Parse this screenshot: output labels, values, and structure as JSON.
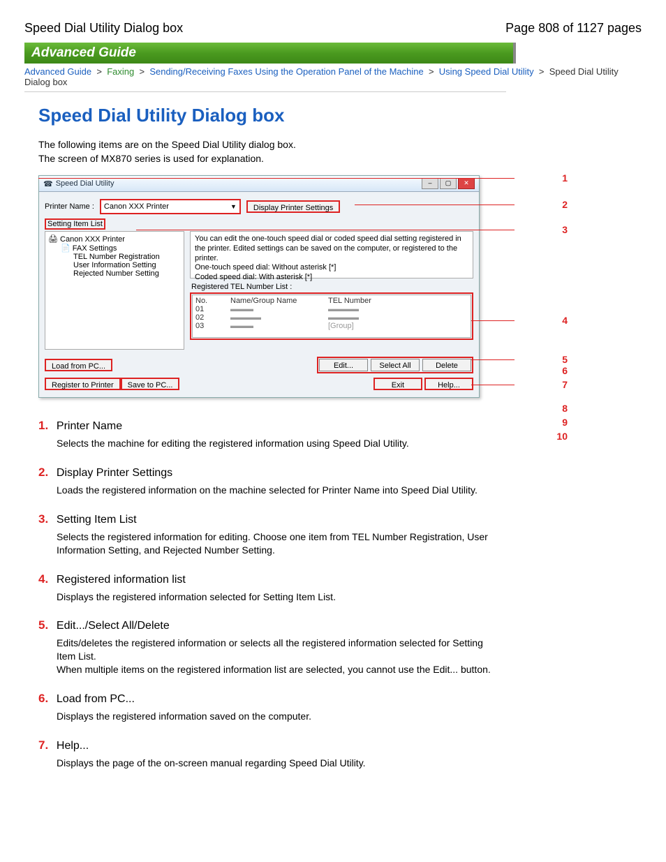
{
  "header": {
    "page_title": "Speed Dial Utility Dialog box",
    "page_counter": "Page 808 of 1127 pages"
  },
  "banner": "Advanced Guide",
  "breadcrumb": {
    "b1": "Advanced Guide",
    "sep": " > ",
    "b2": "Faxing",
    "b3": "Sending/Receiving Faxes Using the Operation Panel of the Machine",
    "b4": "Using Speed Dial Utility",
    "b5": "Speed Dial Utility Dialog box"
  },
  "title": "Speed Dial Utility Dialog box",
  "intro": {
    "p1": "The following items are on the Speed Dial Utility dialog box.",
    "p2": "The screen of MX870 series is used for explanation."
  },
  "dialog": {
    "titlebar": "Speed Dial Utility",
    "printer_name_label": "Printer Name :",
    "printer_name_value": "Canon XXX Printer",
    "display_settings_btn": "Display Printer Settings",
    "setting_item_list_label": "Setting Item List",
    "tree": {
      "root": "Canon XXX Printer",
      "fax": "FAX Settings",
      "tel": "TEL Number Registration",
      "user": "User Information Setting",
      "rej": "Rejected Number Setting"
    },
    "desc_line1": "You can edit the one-touch speed dial or coded speed dial setting registered in the printer. Edited settings can be saved on the computer, or registered to the printer.",
    "desc_line2": "One-touch speed dial: Without asterisk [*]",
    "desc_line3": "Coded speed dial: With asterisk [*]",
    "reg_label": "Registered TEL Number List :",
    "list": {
      "hdr_no": "No.",
      "hdr_name": "Name/Group Name",
      "hdr_tel": "TEL Number",
      "r1_no": "01",
      "r2_no": "02",
      "r3_no": "03",
      "r3_tel": "[Group]"
    },
    "load_btn": "Load from PC...",
    "edit_btn": "Edit...",
    "selectall_btn": "Select All",
    "delete_btn": "Delete",
    "register_btn": "Register to Printer",
    "save_btn": "Save to PC...",
    "exit_btn": "Exit",
    "help_btn": "Help..."
  },
  "callouts": {
    "c1": "1",
    "c2": "2",
    "c3": "3",
    "c4": "4",
    "c5": "5",
    "c6": "6",
    "c7": "7",
    "c8": "8",
    "c9": "9",
    "c10": "10"
  },
  "steps": [
    {
      "num": "1.",
      "title": "Printer Name",
      "desc": "Selects the machine for editing the registered information using Speed Dial Utility."
    },
    {
      "num": "2.",
      "title": "Display Printer Settings",
      "desc": "Loads the registered information on the machine selected for Printer Name into Speed Dial Utility."
    },
    {
      "num": "3.",
      "title": "Setting Item List",
      "desc": "Selects the registered information for editing. Choose one item from TEL Number Registration, User Information Setting, and Rejected Number Setting."
    },
    {
      "num": "4.",
      "title": "Registered information list",
      "desc": "Displays the registered information selected for Setting Item List."
    },
    {
      "num": "5.",
      "title": "Edit.../Select All/Delete",
      "desc": "Edits/deletes the registered information or selects all the registered information selected for Setting Item List.\nWhen multiple items on the registered information list are selected, you cannot use the Edit... button."
    },
    {
      "num": "6.",
      "title": "Load from PC...",
      "desc": "Displays the registered information saved on the computer."
    },
    {
      "num": "7.",
      "title": "Help...",
      "desc": "Displays the page of the on-screen manual regarding Speed Dial Utility."
    }
  ]
}
